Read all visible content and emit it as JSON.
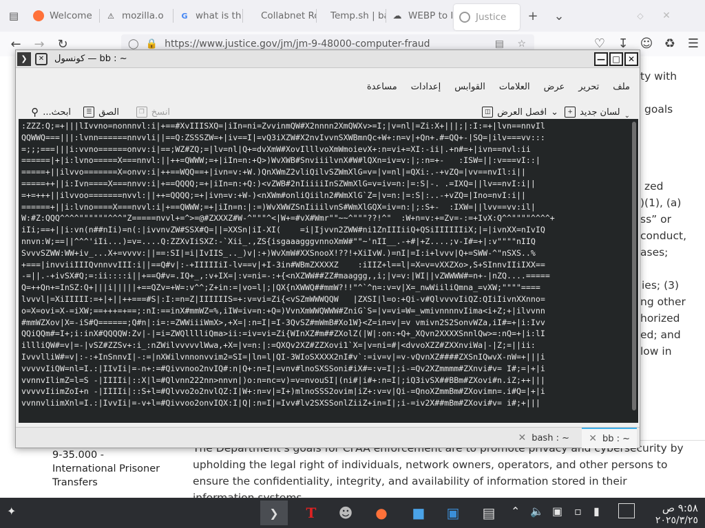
{
  "browser": {
    "tabs": [
      {
        "label": "Welcome",
        "icon": "firefox-icon"
      },
      {
        "label": "mozilla.o",
        "icon": "warning-icon"
      },
      {
        "label": "what is th",
        "icon": "google-icon"
      },
      {
        "label": "Collabnet Ro",
        "icon": "blank-icon"
      },
      {
        "label": "Temp.sh | ba",
        "icon": "blank-icon"
      },
      {
        "label": "WEBP to I",
        "icon": "cloud-icon"
      },
      {
        "label": "Justice",
        "icon": "seal-icon"
      }
    ],
    "new_tab_label": "+",
    "url": "https://www.justice.gov/jm/jm-9-48000-computer-fraud"
  },
  "page_behind": {
    "right_fragments": [
      "ty with",
      "goals",
      "zed",
      ")(1), (a)",
      "ss” or",
      "conduct,",
      "ases;",
      "ies; (3)",
      "ng other",
      "horized",
      "ed; and",
      "low in"
    ],
    "left_lines": [
      "9-35.000 -",
      "International Prisoner",
      "Transfers"
    ],
    "paragraph": "The Department’s goals for CFAA enforcement are to promote privacy and cybersecurity by upholding the legal right of individuals, network owners, operators, and other persons to ensure the confidentiality, integrity, and availability of information stored in their information systems."
  },
  "konsole": {
    "title": "كونسول — bb : ~",
    "menu": [
      "ملف",
      "تحرير",
      "عرض",
      "العلامات",
      "القوابس",
      "إعدادات",
      "مساعدة"
    ],
    "toolbar": {
      "new_tab": "لسان جديد",
      "split_view": "افصل العرض",
      "copy": "انسخ",
      "paste": "الصق",
      "find": "...ابحث"
    },
    "terminal_lines": [
      ":ZZZ:Q;=+|||lIvvno=nonnnvl:i|+==#XvIIISXQ=|iIn=ni=ZvvinmQW#X2nnnn2XmQWXv>=I;|v=nl|=Zi:X+|||;|:I:=+|lvn==nnvIl",
      "QQWWQ===|||:lvnn======nnvvli||==Q:ZSSSZW=+|iv==I|=vQ3iXZW#X2nvIvvnSXWBmnQc+W+:n=v|+Qn+.#=QQ+-|SQ=|ilv===vv:::",
      "=;;;===|||i:vvno======onvv:i|==;WZ#ZQ;=|lv=nl|Q+=dvXmW#XovIlllvoXmWmoievX+:n=vi+=XI:-ii|.+n#=+|ivn==nvl:ii",
      "======|+|i:lvno=====X===nnvl:||++=QWWW;=+|iIn=n:+Q>)WvXWB#SnviiilvnX#W#lQXn=iv=v:|;:n=+-   :ISW=||:v===vI::|",
      "=====+||ilvvo=======X=onvv:i|++==WQQ==+|ivn=v:+W.)QnXWmZ2vliQilvSZWmXlG=v=|v=nl|=QXi:.-+vZQ=|vv==nvIl:i||",
      "=====++||i:Ivn====X===nnvv:i|+==QQQQ;=+|iIn=n:+Q:)<vZWB#2nIiiiiInSZWmXlG=v=iv=n:|=:S|-. .=IXQ=||lv==nvI:i||",
      "=+=+++||ilvvoo=======nvvl:||++=QQQQ;=+|ivn=v:+W-)<nXWm#onliQiiln2#WmXlG`Z=|v=n:|=:S|:..-+vZQ=|Ino=nvI:i||",
      "======+||i:lvno====X===nvvl:i|+==QWWW;=+|iIn=n:|:=)WvXWWZSnIiiilvnS#WmXlGQX=iv=n:|;:S+-  :IXW=||lvv==vv:il|",
      "W:#Z:QQQ^^^^\"\"\"\"\"\"^^^\"Z=====nvvl+=^>=@#ZXXXZ#W-^\"\"\"^<|W+=#vX#Wmr\"\"~~^\"\"\"??!^\"  :W+n=v:+=Zv=-:=+IvX:Q^^\"\"\"\"^^^^+",
      "iIi;==+||i:vn(n##nIi)=n(:|ivvnvZW#SSX#Q=||=XXSn|iI-XI(    =i|Ijvvn2ZWW#ni1ZnIIIiiQ+QSiIIIIIIiX;|=|ivnXX=nIvIQ",
      "nnvn:W;==||^^^'iIi...)=v=....Q:ZZXvIiSXZ:-`Xii_.,ZS{isgaaagggvnnoXmW#\"\"~'nII__.-+#|+Z....;v-I#=+|:v\"\"\"\"nIIQ",
      "SvvvSZWW:WW+iv_...X+=vvvv:||==:SI|=i|IvIIS_.._)v|:+)WvXmW#XXSnooX!??!+XiIvW.)=nI|=I:i+lvvv|Q+=SWW-^\"nSXS..%",
      "+===|invviiIIIQvnnvvIII:i||==Q#v|:-+IIIIIiI-lv==v|+I-3in#WBmZXXXXZ    :iIIZ+l==l|=X=v=vXXZXo>,S+SInnvIIiIXX==",
      "-=||.-+ivSX#Q;=:ii::::i||+==Q#v=.IQ+_,:v+IX=|:v=ni=-:+{<nXZWW##ZZ#maaggg,,i;|v=v:|WI||vZWWWW#=n+-|nZQ....=====",
      "Q=++Qn+=InSZ:Q+|||i|||||+==QZv=+W=:v^^;Z+in:=|vo=l|;|QX{nXWWQ##mmW?!!\"^`^n=:v=v|X=_nwWiiliQmna_=vXW;\"\"\"\"====",
      "lvvvl|=XiIIIII:=+|+||++===#S|:I:=n=Z|IIIIIIS=+:v=vi=Zi{<vSZmWWWQQW   |ZXSI|l=o:+Qi-v#QlvvvvIiQZ:QIiIivnXXnno=",
      "o=X=ovi=X-=iXW;==+++=+==;:nI:==inX#mmWZ=%,iIW=iv=n:+Q=)VvnXmWWQWWW#ZniG`S=|v=vi=W=_wmivnnnnvIima<i+Z;+|ilvvnn",
      "#mmWZXov|X=-iS#Q======;Q#n|:i=:=ZWWiiiWmX>,+X=|:n=I|=I-3QvSZ#mWmB#Xo1W}<Z=in=v|=v vmivn2S2SonvWZa,iI#=+|i:Ivv",
      "QQiQQm#=I+;i:inX#QQQQW:Zv|-|=i=ZWQlllliQma>ii:=iv=vi=Zi{WInXZ#m##ZXolZ(|W|:on:+Q+_XQvn2XXXXSnnlQw>=:nQ=+|i:lI",
      "illliQW#=v|=-|vSZ#ZZSv+:i_:nZWilvvvvvlWwa,+X=|v=n:|:=QXQv2XZ#ZZXovi1`X=|v=ni=#|<dvvoXZZ#ZXXnviWa|-|Z;=||ii:",
      "IvvvlliW#=v|:-:+InSnnvI|-:=|nXWilvnnonvvim2=SI=|ln=l|QI-3WIoSXXXX2nI#v`:=iv=v|=v-vQvnXZ####ZXSnIQwvX-nW=+|||i",
      "vvvvvIiQW=nl=I.:|IIvIi|=-n+:=#Qivvnoo2nvIQ#:n|Q+:n=I|=vnv#lnoSXSSoni#iX#=:v=I|;i-=Qv2XZmmmm#ZXnvi#v= I#;=|+|i",
      "vvnnvIlimZ=l=S -|IIIIi|::X|l=#Qlvnn222nn>nnvn|)o:n=nc=v)=v=nvouSI|(ni#|i#+:n=I|;iQ3ivSX##BBm#ZXovi#n.iZ;++|||",
      "vvvvvIiimZoI+n -|IIIIi|::S+l=#Qlvvo2o2nvlQZ:I|W+:n=v|=I+)mlnoSSS2ovim|iZ+:v=v|Qi-=QnoXZmmBm#ZXovimn=.i#Q=|+|i",
      "vvnnvliimXnl=I.:|IvvIi|=-v+l=#Qivvoo2onvIQX:I|Q|:n=I|=Ivv#lv2SXSSonlZiiZ+in=I|;i-=iv2X##mBm#ZXovi#v= i#;+|||"
    ],
    "tabs": [
      {
        "label": "bash : ~",
        "active": false
      },
      {
        "label": "bb : ~",
        "active": true
      }
    ]
  },
  "taskbar": {
    "time": "٩:٥٨ ص",
    "date": "٢٠٢٥/٣/٢٥",
    "apps": [
      "konsole-icon",
      "text-editor-icon",
      "gimp-icon",
      "firefox-icon",
      "files-icon",
      "store-icon",
      "settings-icon"
    ]
  },
  "colors": {
    "terminal_bg": "#232627",
    "taskbar_bg": "#2b2d31",
    "accent": "#3daee9"
  }
}
